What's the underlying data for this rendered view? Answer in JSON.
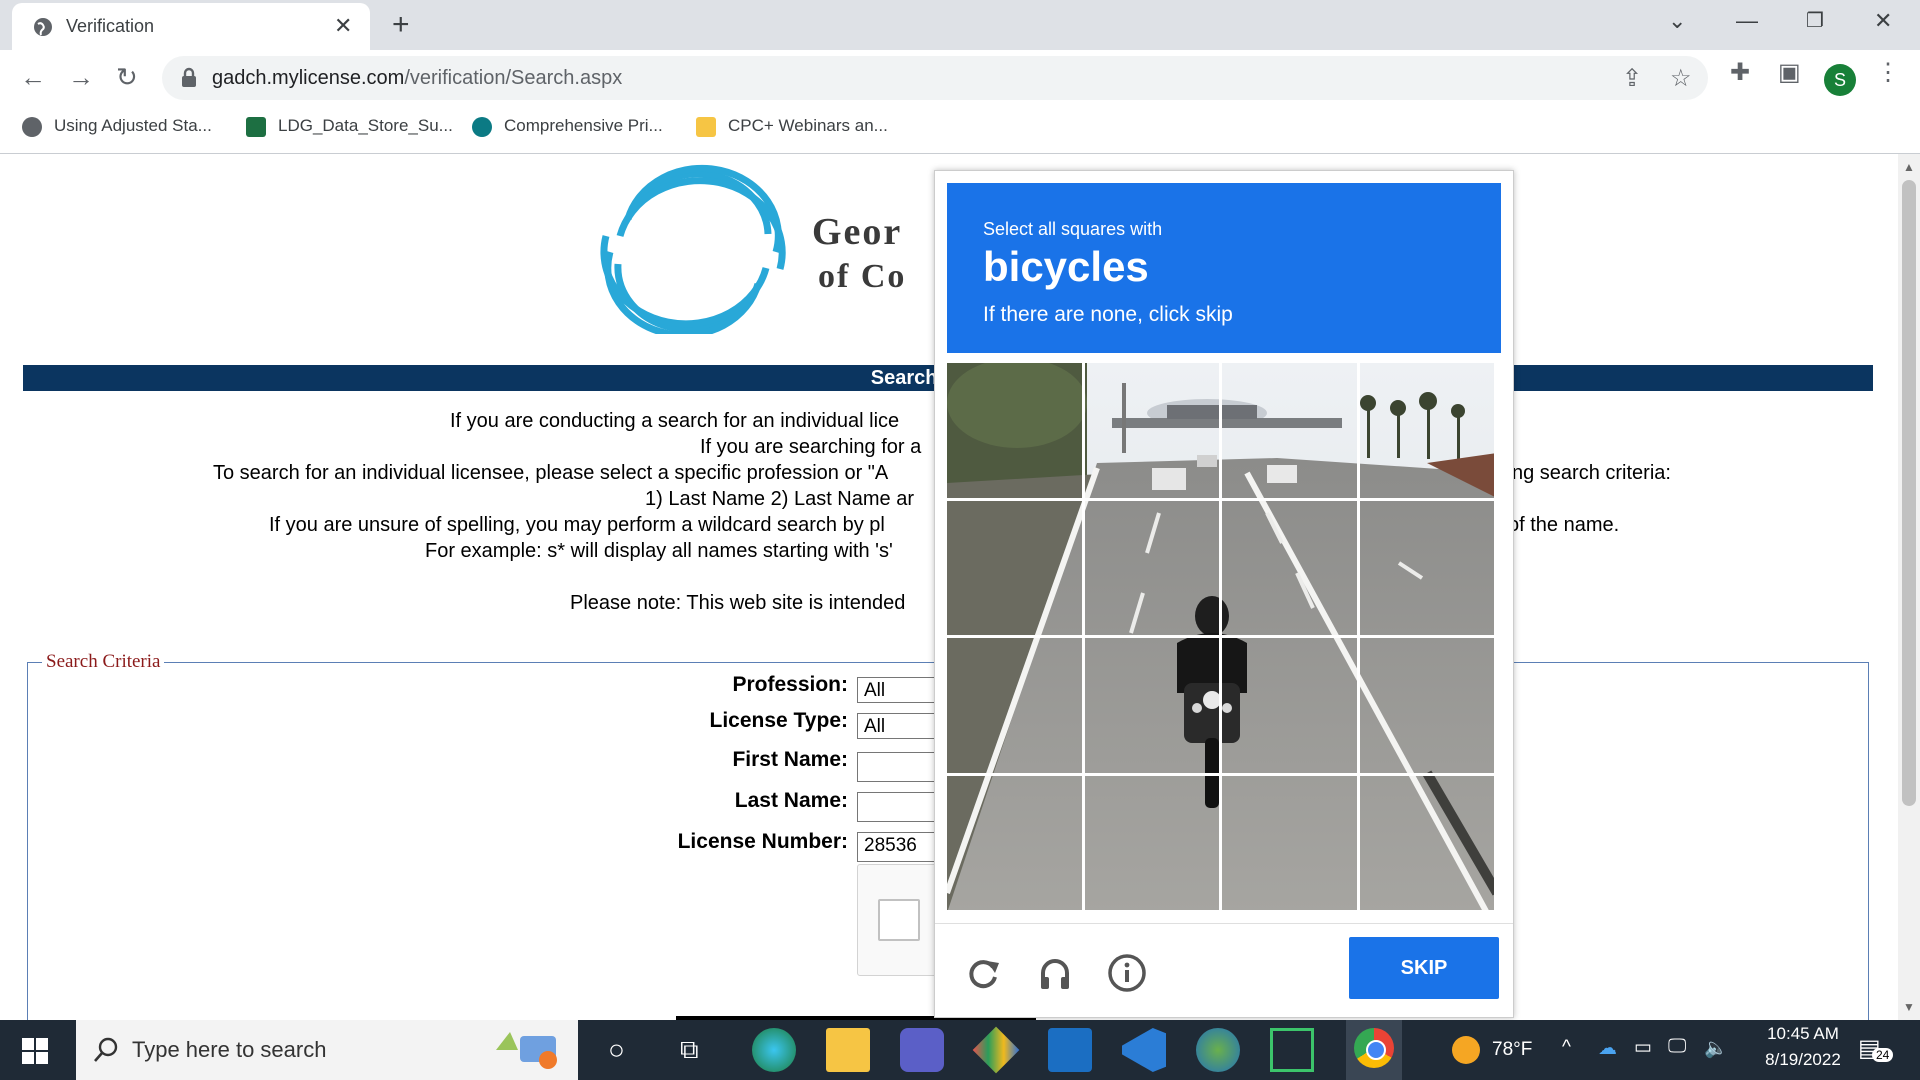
{
  "browser": {
    "tab_title": "Verification",
    "url_host": "gadch.mylicense.com",
    "url_path": "/verification/Search.aspx",
    "profile_initial": "S",
    "bookmarks": [
      "Using Adjusted Sta...",
      "LDG_Data_Store_Su...",
      "Comprehensive Pri...",
      "CPC+ Webinars an..."
    ]
  },
  "page": {
    "org_line1": "Geor",
    "org_line2": "of Co",
    "search_bar_title": "Search for a Pro",
    "intro_lines": [
      "If you are conducting a search for an individual lice",
      "If you are searching for a",
      "To search for an individual licensee, please select a specific profession or \"A",
      "ng search criteria:",
      "1) Last Name 2) Last Name ar",
      "If you are unsure of spelling, you may perform a wildcard search by pl",
      "of the name.",
      "For example: s* will display all names starting with 's'",
      "Please note: This web site is intended"
    ],
    "criteria_legend": "Search Criteria",
    "form": {
      "profession_label": "Profession:",
      "profession_value": "All",
      "license_type_label": "License Type:",
      "license_type_value": "All",
      "first_name_label": "First Name:",
      "first_name_value": "",
      "last_name_label": "Last Name:",
      "last_name_value": "",
      "license_number_label": "License Number:",
      "license_number_value": "28536"
    }
  },
  "captcha": {
    "instruction": "Select all squares with",
    "target": "bicycles",
    "hint": "If there are none, click skip",
    "skip_label": "SKIP",
    "grid_size": 4,
    "icons": [
      "reload-icon",
      "audio-icon",
      "info-icon"
    ]
  },
  "taskbar": {
    "search_placeholder": "Type here to search",
    "weather": "78°F",
    "time": "10:45 AM",
    "date": "8/19/2022",
    "notification_count": "24"
  },
  "colors": {
    "captcha_blue": "#1a73e8",
    "search_bar_navy": "#0b3560",
    "legend_red": "#8b1a1a",
    "taskbar": "#1f2a36"
  }
}
